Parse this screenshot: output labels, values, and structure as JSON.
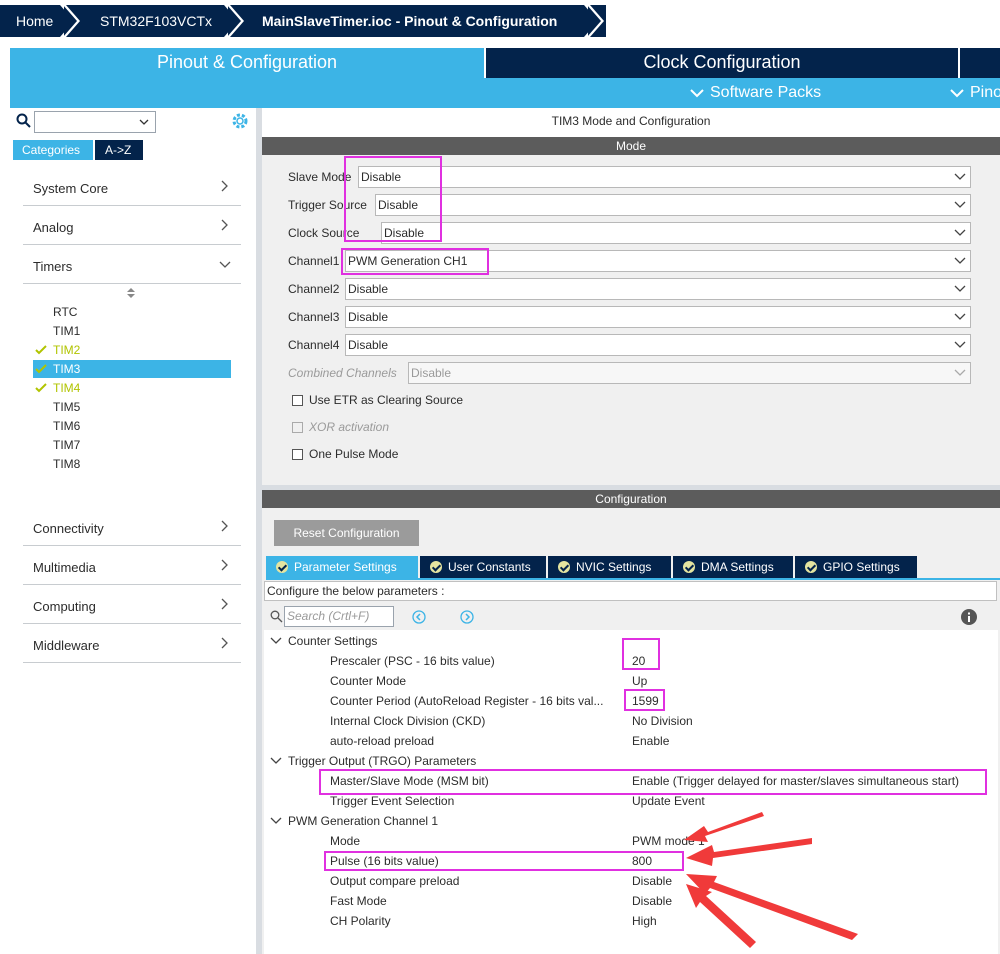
{
  "breadcrumb": {
    "home": "Home",
    "mcu": "STM32F103VCTx",
    "file": "MainSlaveTimer.ioc - Pinout & Configuration"
  },
  "tabs": {
    "pinout": "Pinout & Configuration",
    "clock": "Clock Configuration",
    "software_packs": "Software Packs",
    "pinout_view": "Pino"
  },
  "sidebar": {
    "search_value": "",
    "tab_categories": "Categories",
    "tab_az": "A->Z",
    "categories": [
      {
        "label": "System Core"
      },
      {
        "label": "Analog"
      },
      {
        "label": "Timers"
      },
      {
        "label": "Connectivity"
      },
      {
        "label": "Multimedia"
      },
      {
        "label": "Computing"
      },
      {
        "label": "Middleware"
      }
    ],
    "timers": [
      {
        "label": "RTC",
        "checked": false
      },
      {
        "label": "TIM1",
        "checked": false
      },
      {
        "label": "TIM2",
        "checked": true
      },
      {
        "label": "TIM3",
        "checked": true,
        "selected": true
      },
      {
        "label": "TIM4",
        "checked": true
      },
      {
        "label": "TIM5",
        "checked": false
      },
      {
        "label": "TIM6",
        "checked": false
      },
      {
        "label": "TIM7",
        "checked": false
      },
      {
        "label": "TIM8",
        "checked": false
      }
    ]
  },
  "mode": {
    "title": "TIM3 Mode and Configuration",
    "header": "Mode",
    "fields": [
      {
        "label": "Slave Mode",
        "value": "Disable"
      },
      {
        "label": "Trigger Source",
        "value": "Disable"
      },
      {
        "label": "Clock Source",
        "value": "Disable"
      },
      {
        "label": "Channel1",
        "value": "PWM Generation CH1"
      },
      {
        "label": "Channel2",
        "value": "Disable"
      },
      {
        "label": "Channel3",
        "value": "Disable"
      },
      {
        "label": "Channel4",
        "value": "Disable"
      },
      {
        "label": "Combined Channels",
        "value": "Disable"
      }
    ],
    "checks": [
      {
        "label": "Use ETR as Clearing Source"
      },
      {
        "label": "XOR activation"
      },
      {
        "label": "One Pulse Mode"
      }
    ]
  },
  "config": {
    "header": "Configuration",
    "reset_label": "Reset Configuration",
    "tabs": [
      "Parameter Settings",
      "User Constants",
      "NVIC Settings",
      "DMA Settings",
      "GPIO Settings"
    ],
    "description": "Configure the below parameters :",
    "search_placeholder": "Search (Crtl+F)",
    "groups": [
      {
        "title": "Counter Settings",
        "params": [
          {
            "name": "Prescaler (PSC - 16 bits value)",
            "value": "20"
          },
          {
            "name": "Counter Mode",
            "value": "Up"
          },
          {
            "name": "Counter Period (AutoReload Register - 16 bits val...",
            "value": "1599"
          },
          {
            "name": "Internal Clock Division (CKD)",
            "value": "No Division"
          },
          {
            "name": "auto-reload preload",
            "value": "Enable"
          }
        ]
      },
      {
        "title": "Trigger Output (TRGO) Parameters",
        "params": [
          {
            "name": "Master/Slave Mode (MSM bit)",
            "value": "Enable (Trigger delayed for master/slaves simultaneous start)"
          },
          {
            "name": "Trigger Event Selection",
            "value": "Update Event"
          }
        ]
      },
      {
        "title": "PWM Generation Channel 1",
        "params": [
          {
            "name": "Mode",
            "value": "PWM mode 1"
          },
          {
            "name": "Pulse (16 bits value)",
            "value": "800"
          },
          {
            "name": "Output compare preload",
            "value": "Disable"
          },
          {
            "name": "Fast Mode",
            "value": "Disable"
          },
          {
            "name": "CH Polarity",
            "value": "High"
          }
        ]
      }
    ]
  },
  "colors": {
    "navy": "#03234b",
    "accent": "#3cb4e6",
    "highlight": "#e030e0",
    "arrow": "#f03a3a",
    "check": "#b1c400"
  }
}
